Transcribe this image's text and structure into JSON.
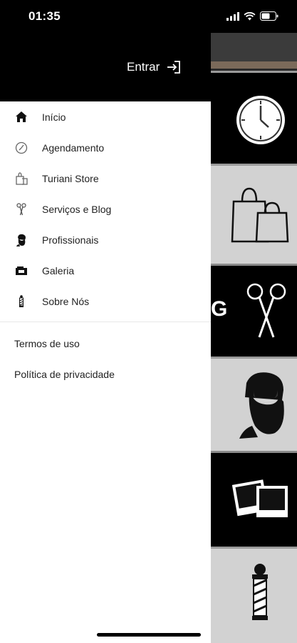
{
  "status_bar": {
    "time": "01:35"
  },
  "drawer": {
    "login_label": "Entrar",
    "menu_items": [
      {
        "label": "Início",
        "icon": "home-icon"
      },
      {
        "label": "Agendamento",
        "icon": "clock-icon"
      },
      {
        "label": "Turiani Store",
        "icon": "store-icon"
      },
      {
        "label": "Serviços e Blog",
        "icon": "scissors-icon"
      },
      {
        "label": "Profissionais",
        "icon": "barber-icon"
      },
      {
        "label": "Galeria",
        "icon": "gallery-icon"
      },
      {
        "label": "Sobre Nós",
        "icon": "barber-pole-icon"
      }
    ],
    "links": [
      {
        "label": "Termos de uso"
      },
      {
        "label": "Política de privacidade"
      }
    ]
  },
  "background_app": {
    "tiles": [
      {
        "icon": "clock-icon"
      },
      {
        "icon": "shopping-bags-icon"
      },
      {
        "icon": "scissors-icon",
        "text_fragment": "G"
      },
      {
        "icon": "bearded-man-icon"
      },
      {
        "icon": "photos-icon"
      },
      {
        "icon": "barber-pole-icon"
      }
    ]
  }
}
